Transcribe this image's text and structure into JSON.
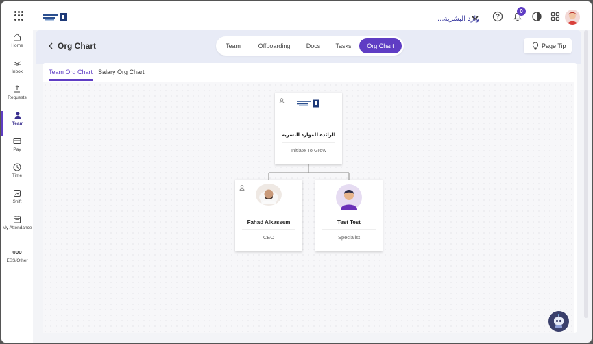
{
  "topbar": {
    "company_name": "...وارد البشرية",
    "notification_count": "0"
  },
  "sidebar": {
    "items": [
      {
        "label": "Home",
        "icon": "home-icon"
      },
      {
        "label": "Inbox",
        "icon": "inbox-icon"
      },
      {
        "label": "Requests",
        "icon": "requests-icon"
      },
      {
        "label": "Team",
        "icon": "team-icon",
        "active": true
      },
      {
        "label": "Pay",
        "icon": "pay-icon"
      },
      {
        "label": "Time",
        "icon": "clock-icon"
      },
      {
        "label": "Shift",
        "icon": "shift-icon"
      },
      {
        "label": "My Attendance",
        "icon": "calendar-icon"
      },
      {
        "label": "ESS/Other",
        "icon": "more-icon"
      }
    ]
  },
  "header": {
    "title": "Org Chart",
    "tabs": [
      {
        "label": "Team"
      },
      {
        "label": "Offboarding"
      },
      {
        "label": "Docs"
      },
      {
        "label": "Tasks"
      },
      {
        "label": "Org Chart",
        "active": true
      }
    ],
    "page_tip_label": "Page Tip"
  },
  "subtabs": [
    {
      "label": "Team Org Chart",
      "active": true
    },
    {
      "label": "Salary Org Chart"
    }
  ],
  "org_chart": {
    "root": {
      "name": "الرائدة للموارد البشرية",
      "role": "Initiate To Grow"
    },
    "children": [
      {
        "name": "Fahad Alkassem",
        "role": "CEO"
      },
      {
        "name": "Test Test",
        "role": "Specialist"
      }
    ]
  },
  "colors": {
    "accent": "#5f3dc4",
    "background": "#f3f4f7"
  }
}
